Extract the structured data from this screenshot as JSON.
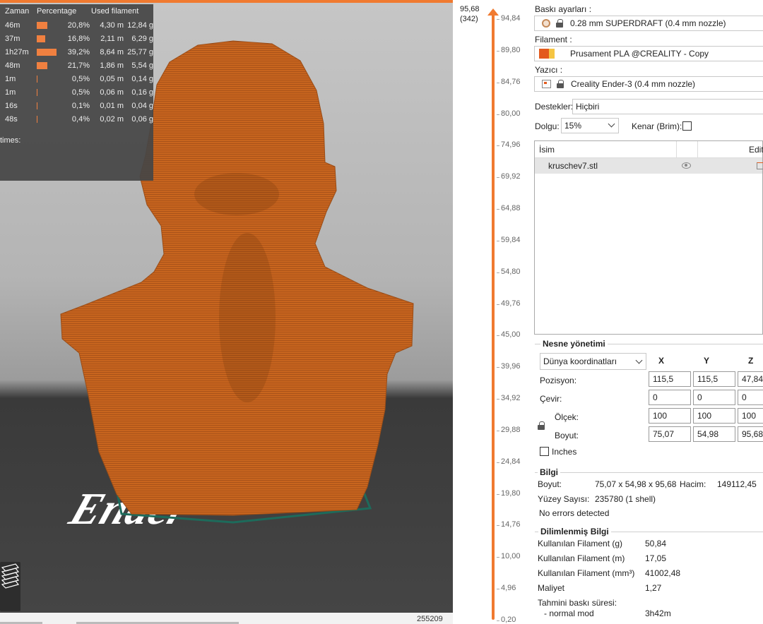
{
  "stats": {
    "headers": {
      "time": "Zaman",
      "percentage": "Percentage",
      "used_filament": "Used filament"
    },
    "rows": [
      {
        "time": "46m",
        "pct": "20,8%",
        "pct_value": 20.8,
        "meters": "4,30 m",
        "grams": "12,84 g"
      },
      {
        "time": "37m",
        "pct": "16,8%",
        "pct_value": 16.8,
        "meters": "2,11 m",
        "grams": "6,29 g"
      },
      {
        "time": "1h27m",
        "pct": "39,2%",
        "pct_value": 39.2,
        "meters": "8,64 m",
        "grams": "25,77 g"
      },
      {
        "time": "48m",
        "pct": "21,7%",
        "pct_value": 21.7,
        "meters": "1,86 m",
        "grams": "5,54 g"
      },
      {
        "time": "1m",
        "pct": "0,5%",
        "pct_value": 0.5,
        "meters": "0,05 m",
        "grams": "0,14 g"
      },
      {
        "time": "1m",
        "pct": "0,5%",
        "pct_value": 0.5,
        "meters": "0,06 m",
        "grams": "0,16 g"
      },
      {
        "time": "16s",
        "pct": "0,1%",
        "pct_value": 0.1,
        "meters": "0,01 m",
        "grams": "0,04 g"
      },
      {
        "time": "48s",
        "pct": "0,4%",
        "pct_value": 0.4,
        "meters": "0,02 m",
        "grams": "0,06 g"
      }
    ],
    "footer": "times:"
  },
  "viewport": {
    "bed_logo_text": "Ender",
    "layer_counter": "255209"
  },
  "slider": {
    "top_value": "95,68",
    "top_layer": "(342)",
    "ticks": [
      "94,84",
      "89,80",
      "84,76",
      "80,00",
      "74,96",
      "69,92",
      "64,88",
      "59,84",
      "54,80",
      "49,76",
      "45,00",
      "39,96",
      "34,92",
      "29,88",
      "24,84",
      "19,80",
      "14,76",
      "10,00",
      "4,96",
      "0,20"
    ]
  },
  "panel": {
    "print_settings_label": "Baskı ayarları :",
    "print_settings_value": "0.28 mm SUPERDRAFT (0.4 mm nozzle)",
    "filament_label": "Filament :",
    "filament_value": "Prusament PLA @CREALITY - Copy",
    "printer_label": "Yazıcı :",
    "printer_value": "Creality Ender-3 (0.4 mm nozzle)",
    "supports_label": "Destekler:",
    "supports_value": "Hiçbiri",
    "infill_label": "Dolgu:",
    "infill_value": "15%",
    "brim_label": "Kenar (Brim):",
    "list_col_name": "İsim",
    "list_col_edit": "Editi",
    "object_name": "kruschev7.stl",
    "manipulation_title": "Nesne yönetimi",
    "coord_system": "Dünya koordinatları",
    "axes": [
      "X",
      "Y",
      "Z"
    ],
    "position_label": "Pozisyon:",
    "rotate_label": "Çevir:",
    "scale_label": "Ölçek:",
    "size_label": "Boyut:",
    "position": [
      "115,5",
      "115,5",
      "47,84"
    ],
    "rotation": [
      "0",
      "0",
      "0"
    ],
    "scale": [
      "100",
      "100",
      "100"
    ],
    "size": [
      "75,07",
      "54,98",
      "95,68"
    ],
    "inches_label": "Inches",
    "info_title": "Bilgi",
    "info_size_label": "Boyut:",
    "info_size_value": "75,07 x 54,98 x 95,68",
    "info_volume_label": "Hacim:",
    "info_volume_value": "149112,45",
    "info_facets_label": "Yüzey Sayısı:",
    "info_facets_value": "235780 (1 shell)",
    "info_errors": "No errors detected",
    "sliced_title": "Dilimlenmiş Bilgi",
    "filament_g_label": "Kullanılan Filament (g)",
    "filament_g_value": "50,84",
    "filament_m_label": "Kullanılan Filament (m)",
    "filament_m_value": "17,05",
    "filament_mm3_label": "Kullanılan Filament (mm³)",
    "filament_mm3_value": "41002,48",
    "cost_label": "Maliyet",
    "cost_value": "1,27",
    "est_time_label": "Tahmini baskı süresi:",
    "normal_mode_label": "- normal mod",
    "normal_mode_value": "3h42m"
  },
  "colors": {
    "accent": "#f07a30",
    "model": "#c8651e",
    "stats_bar": "#f08040"
  }
}
